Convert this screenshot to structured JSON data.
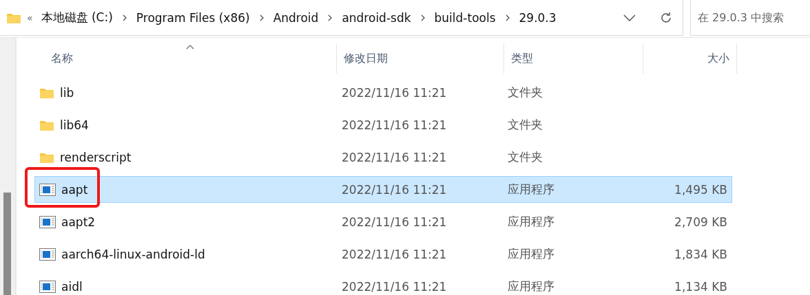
{
  "address_bar": {
    "overflow": "«",
    "crumbs": [
      "本地磁盘 (C:)",
      "Program Files (x86)",
      "Android",
      "android-sdk",
      "build-tools",
      "29.0.3"
    ]
  },
  "search": {
    "placeholder": "在 29.0.3 中搜索"
  },
  "table": {
    "columns": [
      "名称",
      "修改日期",
      "类型",
      "大小"
    ],
    "rows": [
      {
        "kind": "folder",
        "name": "lib",
        "date": "2022/11/16 11:21",
        "type": "文件夹",
        "selected": false,
        "annotated": false
      },
      {
        "kind": "folder",
        "name": "lib64",
        "date": "2022/11/16 11:21",
        "type": "文件夹",
        "selected": false,
        "annotated": false
      },
      {
        "kind": "folder",
        "name": "renderscript",
        "date": "2022/11/16 11:21",
        "type": "文件夹",
        "selected": false,
        "annotated": false
      },
      {
        "kind": "app",
        "name": "aapt",
        "date": "2022/11/16 11:21",
        "type": "应用程序",
        "size": "1,495 KB",
        "selected": true,
        "annotated": true
      },
      {
        "kind": "app",
        "name": "aapt2",
        "date": "2022/11/16 11:21",
        "type": "应用程序",
        "size": "2,709 KB",
        "selected": false,
        "annotated": false
      },
      {
        "kind": "app",
        "name": "aarch64-linux-android-ld",
        "date": "2022/11/16 11:21",
        "type": "应用程序",
        "size": "1,834 KB",
        "selected": false,
        "annotated": false
      },
      {
        "kind": "app",
        "name": "aidl",
        "date": "2022/11/16 11:21",
        "type": "应用程序",
        "size": "1,134 KB",
        "selected": false,
        "annotated": false
      }
    ]
  }
}
